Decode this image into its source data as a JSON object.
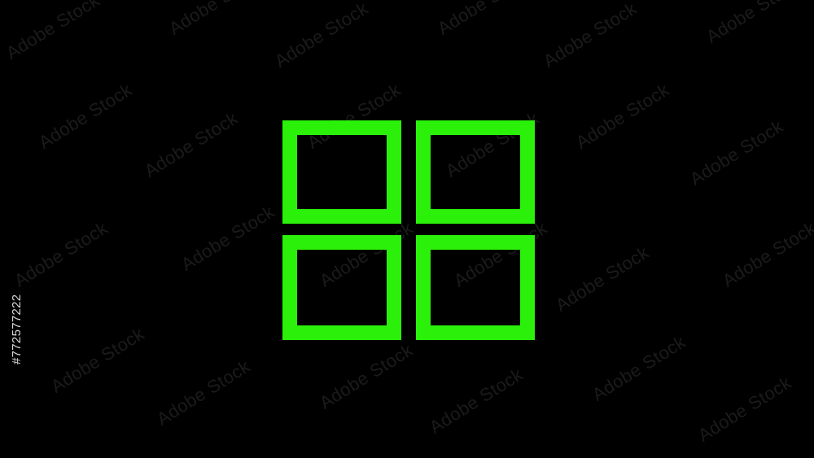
{
  "icon": {
    "name": "grid-icon",
    "tiles": 4,
    "color": "#2af00a"
  },
  "background": "#000000",
  "watermark": {
    "text": "Adobe Stock"
  },
  "stock_id": {
    "text": "#772577222"
  }
}
